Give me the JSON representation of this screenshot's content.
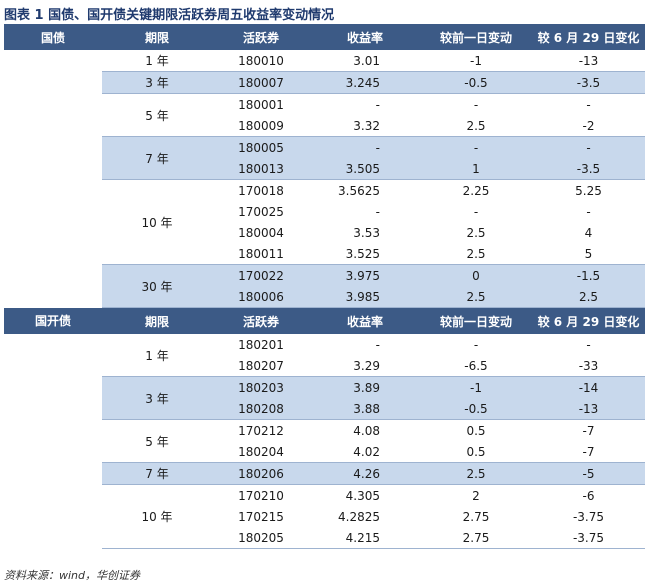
{
  "title": "图表 1   国债、国开债关键期限活跃券周五收益率变动情况",
  "headers1": [
    "国债",
    "期限",
    "活跃券",
    "收益率",
    "较前一日变动",
    "较 6 月 29 日变化"
  ],
  "headers2": [
    "国开债",
    "期限",
    "活跃券",
    "收益率",
    "较前一日变动",
    "较 6 月 29 日变化"
  ],
  "gov": [
    {
      "term": "1 年",
      "bond": "180010",
      "yield": "3.01",
      "d1": "-1",
      "d2": "-13"
    },
    {
      "term": "3 年",
      "bond": "180007",
      "yield": "3.245",
      "d1": "-0.5",
      "d2": "-3.5"
    },
    {
      "term": "5 年",
      "bond": "180001",
      "yield": "-",
      "d1": "-",
      "d2": "-"
    },
    {
      "term": "",
      "bond": "180009",
      "yield": "3.32",
      "d1": "2.5",
      "d2": "-2"
    },
    {
      "term": "7 年",
      "bond": "180005",
      "yield": "-",
      "d1": "-",
      "d2": "-"
    },
    {
      "term": "",
      "bond": "180013",
      "yield": "3.505",
      "d1": "1",
      "d2": "-3.5"
    },
    {
      "term": "10 年",
      "bond": "170018",
      "yield": "3.5625",
      "d1": "2.25",
      "d2": "5.25"
    },
    {
      "term": "",
      "bond": "170025",
      "yield": "-",
      "d1": "-",
      "d2": "-"
    },
    {
      "term": "",
      "bond": "180004",
      "yield": "3.53",
      "d1": "2.5",
      "d2": "4"
    },
    {
      "term": "",
      "bond": "180011",
      "yield": "3.525",
      "d1": "2.5",
      "d2": "5"
    },
    {
      "term": "30 年",
      "bond": "170022",
      "yield": "3.975",
      "d1": "0",
      "d2": "-1.5"
    },
    {
      "term": "",
      "bond": "180006",
      "yield": "3.985",
      "d1": "2.5",
      "d2": "2.5"
    }
  ],
  "cdb": [
    {
      "term": "1 年",
      "bond": "180201",
      "yield": "-",
      "d1": "-",
      "d2": "-"
    },
    {
      "term": "",
      "bond": "180207",
      "yield": "3.29",
      "d1": "-6.5",
      "d2": "-33"
    },
    {
      "term": "3 年",
      "bond": "180203",
      "yield": "3.89",
      "d1": "-1",
      "d2": "-14"
    },
    {
      "term": "",
      "bond": "180208",
      "yield": "3.88",
      "d1": "-0.5",
      "d2": "-13"
    },
    {
      "term": "5 年",
      "bond": "170212",
      "yield": "4.08",
      "d1": "0.5",
      "d2": "-7"
    },
    {
      "term": "",
      "bond": "180204",
      "yield": "4.02",
      "d1": "0.5",
      "d2": "-7"
    },
    {
      "term": "7 年",
      "bond": "180206",
      "yield": "4.26",
      "d1": "2.5",
      "d2": "-5"
    },
    {
      "term": "10 年",
      "bond": "170210",
      "yield": "4.305",
      "d1": "2",
      "d2": "-6"
    },
    {
      "term": "",
      "bond": "170215",
      "yield": "4.2825",
      "d1": "2.75",
      "d2": "-3.75"
    },
    {
      "term": "",
      "bond": "180205",
      "yield": "4.215",
      "d1": "2.75",
      "d2": "-3.75"
    }
  ],
  "source": "资料来源：wind，华创证券"
}
